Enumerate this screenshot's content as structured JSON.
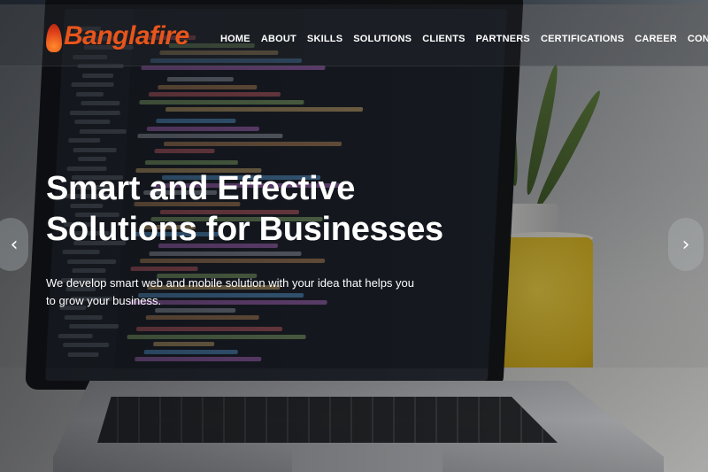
{
  "header": {
    "logo_text": "Banglafire",
    "nav": [
      {
        "label": "HOME",
        "name": "nav-home"
      },
      {
        "label": "ABOUT",
        "name": "nav-about"
      },
      {
        "label": "SKILLS",
        "name": "nav-skills"
      },
      {
        "label": "SOLUTIONS",
        "name": "nav-solutions"
      },
      {
        "label": "CLIENTS",
        "name": "nav-clients"
      },
      {
        "label": "PARTNERS",
        "name": "nav-partners"
      },
      {
        "label": "CERTIFICATIONS",
        "name": "nav-certifications"
      },
      {
        "label": "CAREER",
        "name": "nav-career"
      },
      {
        "label": "CONTACT",
        "name": "nav-contact"
      }
    ]
  },
  "hero": {
    "headline_line1": "Smart and Effective",
    "headline_line2": "Solutions for Businesses",
    "subline": "We develop smart web and mobile solution with your idea that helps you to grow your business."
  },
  "carousel": {
    "prev_icon": "chevron-left-icon",
    "next_icon": "chevron-right-icon"
  },
  "colors": {
    "logo": "#e8551c",
    "text": "#ffffff"
  }
}
